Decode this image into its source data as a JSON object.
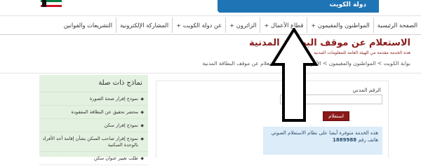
{
  "header": {
    "site_name": "دولة الكويت",
    "flag_colors": [
      "#007a3d",
      "#ffffff",
      "#ce1126"
    ]
  },
  "nav": {
    "items": [
      {
        "label": "الصفحة الرئيسية"
      },
      {
        "label": "المواطنون والمقيمون +"
      },
      {
        "label": "قطاع الأعمال +"
      },
      {
        "label": "الزائرون +"
      },
      {
        "label": "عن دولة الكويت +"
      },
      {
        "label": "المشاركة الإلكترونية"
      },
      {
        "label": "التشريعات والقوانين"
      }
    ]
  },
  "page": {
    "title": "الاستعلام عن موقف البطاقة المدنية",
    "subtitle": "هذه الخدمة مقدمة من الهيئة العامة للمعلومات المدنية",
    "breadcrumb": "بوابة الكويت > المواطنون والمقيمون > الأحوال والأفراد > الاستعلام عن موقف البطاقة المدنية"
  },
  "form": {
    "label": "الرقم المدني",
    "input_value": "",
    "submit_label": "استعلام",
    "info_text": "هذه الخدمة متوفرة أيضا على نظام الاستعلام الصوتي هاتف رقم",
    "info_phone": "1889988"
  },
  "sidebar": {
    "title": "نماذج ذات صلة",
    "items": [
      {
        "label": "نموذج إقرار صحة الصورة"
      },
      {
        "label": "محضر تحقيق عن البطاقة المفقودة"
      },
      {
        "label": "نموذج إقرار سكن"
      },
      {
        "label": "نموذج إقرار صاحب السكن بشأن إقامة أحد الأفراد بالوحدة السكنية"
      },
      {
        "label": "طلب تغيير عنوان سكن"
      }
    ]
  },
  "colors": {
    "accent": "#8a1919",
    "nav_blue": "#1f74b5",
    "sidebar_bg": "#e3f1e0",
    "info_bg": "#dcecf9"
  },
  "overlay": {
    "arrow_icon": "up-arrow-icon"
  }
}
